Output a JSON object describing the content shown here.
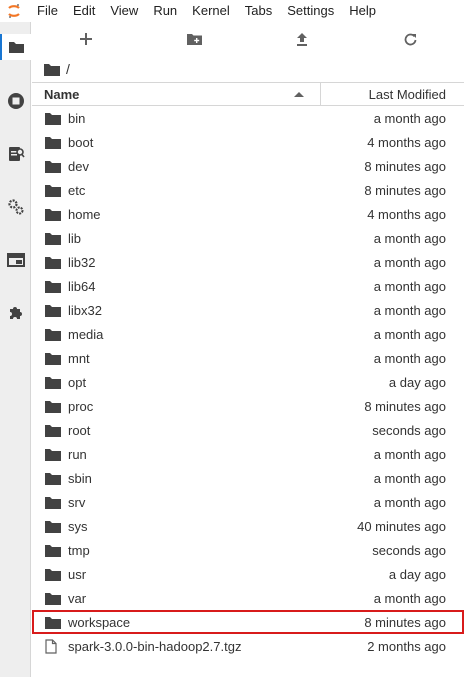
{
  "menubar": {
    "items": [
      "File",
      "Edit",
      "View",
      "Run",
      "Kernel",
      "Tabs",
      "Settings",
      "Help"
    ]
  },
  "sidebar": {
    "icons": [
      "folder-icon",
      "running-icon",
      "commands-icon",
      "property-inspector-icon",
      "tabs-icon",
      "extension-icon"
    ]
  },
  "toolbar": {
    "buttons": [
      "new-launcher-icon",
      "new-folder-icon",
      "upload-icon",
      "refresh-icon"
    ]
  },
  "breadcrumb": {
    "path": "/"
  },
  "listing": {
    "columns": {
      "name": "Name",
      "modified": "Last Modified"
    },
    "rows": [
      {
        "name": "bin",
        "modified": "a month ago",
        "type": "folder"
      },
      {
        "name": "boot",
        "modified": "4 months ago",
        "type": "folder"
      },
      {
        "name": "dev",
        "modified": "8 minutes ago",
        "type": "folder"
      },
      {
        "name": "etc",
        "modified": "8 minutes ago",
        "type": "folder"
      },
      {
        "name": "home",
        "modified": "4 months ago",
        "type": "folder"
      },
      {
        "name": "lib",
        "modified": "a month ago",
        "type": "folder"
      },
      {
        "name": "lib32",
        "modified": "a month ago",
        "type": "folder"
      },
      {
        "name": "lib64",
        "modified": "a month ago",
        "type": "folder"
      },
      {
        "name": "libx32",
        "modified": "a month ago",
        "type": "folder"
      },
      {
        "name": "media",
        "modified": "a month ago",
        "type": "folder"
      },
      {
        "name": "mnt",
        "modified": "a month ago",
        "type": "folder"
      },
      {
        "name": "opt",
        "modified": "a day ago",
        "type": "folder"
      },
      {
        "name": "proc",
        "modified": "8 minutes ago",
        "type": "folder"
      },
      {
        "name": "root",
        "modified": "seconds ago",
        "type": "folder"
      },
      {
        "name": "run",
        "modified": "a month ago",
        "type": "folder"
      },
      {
        "name": "sbin",
        "modified": "a month ago",
        "type": "folder"
      },
      {
        "name": "srv",
        "modified": "a month ago",
        "type": "folder"
      },
      {
        "name": "sys",
        "modified": "40 minutes ago",
        "type": "folder"
      },
      {
        "name": "tmp",
        "modified": "seconds ago",
        "type": "folder"
      },
      {
        "name": "usr",
        "modified": "a day ago",
        "type": "folder"
      },
      {
        "name": "var",
        "modified": "a month ago",
        "type": "folder"
      },
      {
        "name": "workspace",
        "modified": "8 minutes ago",
        "type": "folder",
        "highlighted": true
      },
      {
        "name": "spark-3.0.0-bin-hadoop2.7.tgz",
        "modified": "2 months ago",
        "type": "file"
      }
    ]
  },
  "colors": {
    "accent": "#f37726",
    "highlight_border": "#d81b1b",
    "icon": "#616161"
  }
}
